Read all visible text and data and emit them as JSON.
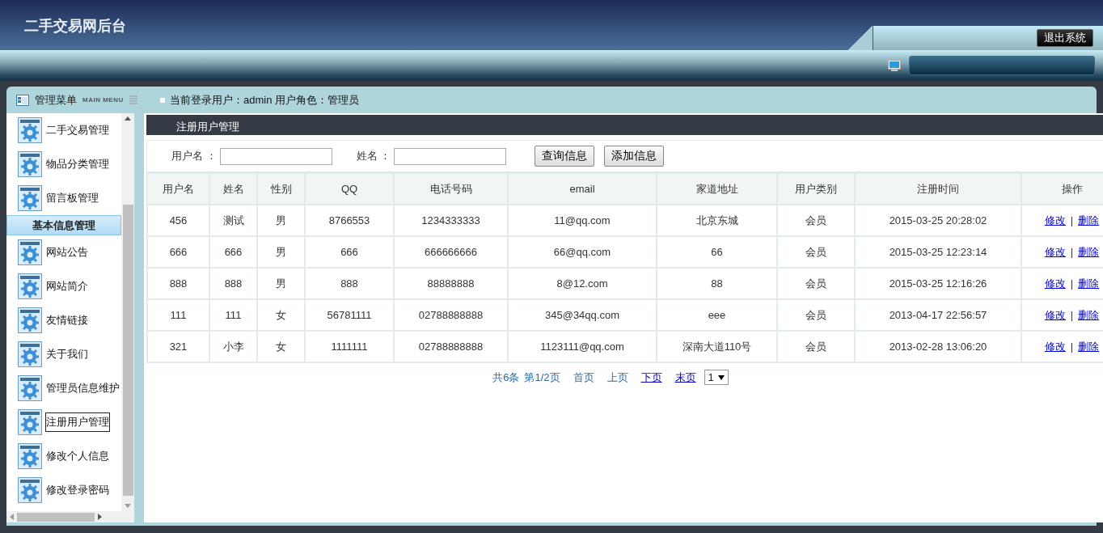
{
  "header": {
    "title": "二手交易网后台",
    "logout": "退出系统"
  },
  "topbar": {
    "menu_title": "管理菜单",
    "menu_subtitle": "MAIN MENU",
    "user_info": "当前登录用户：admin  用户角色：管理员"
  },
  "sidebar": {
    "items": [
      {
        "kind": "item",
        "label": "二手交易管理",
        "selected": false
      },
      {
        "kind": "item",
        "label": "物品分类管理",
        "selected": false
      },
      {
        "kind": "item",
        "label": "留言板管理",
        "selected": false
      },
      {
        "kind": "group",
        "label": "基本信息管理"
      },
      {
        "kind": "item",
        "label": "网站公告",
        "selected": false
      },
      {
        "kind": "item",
        "label": "网站简介",
        "selected": false
      },
      {
        "kind": "item",
        "label": "友情链接",
        "selected": false
      },
      {
        "kind": "item",
        "label": "关于我们",
        "selected": false
      },
      {
        "kind": "item",
        "label": "管理员信息维护",
        "selected": false
      },
      {
        "kind": "item",
        "label": "注册用户管理",
        "selected": true
      },
      {
        "kind": "item",
        "label": "修改个人信息",
        "selected": false
      },
      {
        "kind": "item",
        "label": "修改登录密码",
        "selected": false
      }
    ]
  },
  "content": {
    "title": "注册用户管理",
    "search": {
      "fields": [
        {
          "label": "用户名 ："
        },
        {
          "label": "姓名 ："
        }
      ],
      "buttons": [
        "查询信息",
        "添加信息"
      ]
    },
    "table": {
      "columns": [
        "用户名",
        "姓名",
        "性别",
        "QQ",
        "电话号码",
        "email",
        "家道地址",
        "用户类别",
        "注册时间",
        "操作"
      ],
      "rows": [
        {
          "cells": [
            "456",
            "测试",
            "男",
            "8766553",
            "1234333333",
            "11@qq.com",
            "北京东城",
            "会员",
            "2015-03-25 20:28:02"
          ],
          "actions": [
            "修改",
            "删除"
          ]
        },
        {
          "cells": [
            "666",
            "666",
            "男",
            "666",
            "666666666",
            "66@qq.com",
            "66",
            "会员",
            "2015-03-25 12:23:14"
          ],
          "actions": [
            "修改",
            "删除"
          ]
        },
        {
          "cells": [
            "888",
            "888",
            "男",
            "888",
            "88888888",
            "8@12.com",
            "88",
            "会员",
            "2015-03-25 12:16:26"
          ],
          "actions": [
            "修改",
            "删除"
          ]
        },
        {
          "cells": [
            "111",
            "111",
            "女",
            "56781111",
            "02788888888",
            "345@34qq.com",
            "eee",
            "会员",
            "2013-04-17 22:56:57"
          ],
          "actions": [
            "修改",
            "删除"
          ]
        },
        {
          "cells": [
            "321",
            "小李",
            "女",
            "1111111",
            "02788888888",
            "1123111@qq.com",
            "深南大道110号",
            "会员",
            "2013-02-28 13:06:20"
          ],
          "actions": [
            "修改",
            "删除"
          ]
        }
      ]
    },
    "action_separator": "|",
    "pager": {
      "total": "共6条",
      "page": "第1/2页",
      "links": [
        {
          "label": "首页",
          "disabled": true
        },
        {
          "label": "上页",
          "disabled": true
        },
        {
          "label": "下页",
          "disabled": false
        },
        {
          "label": "末页",
          "disabled": false
        }
      ],
      "select": "1"
    }
  }
}
